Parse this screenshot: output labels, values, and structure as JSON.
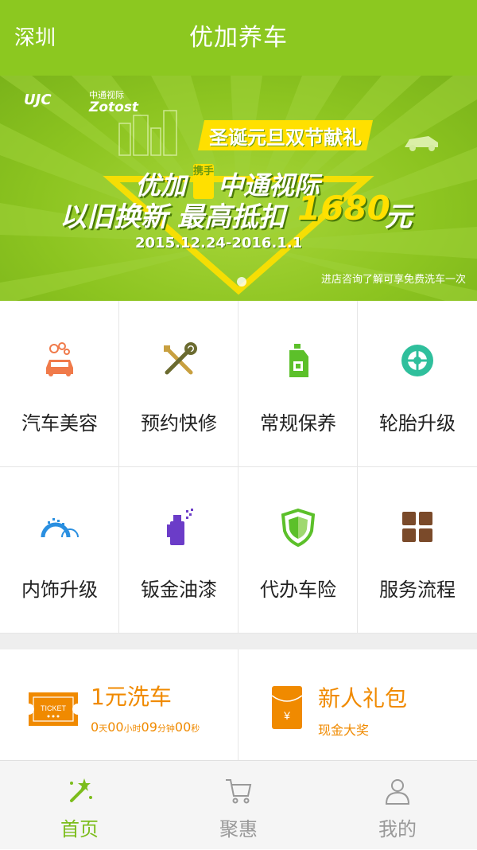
{
  "header": {
    "city": "深圳",
    "title": "优加养车"
  },
  "banner": {
    "brand_logo": "UJC",
    "partner_cn": "中通视际",
    "partner_en": "Zotost",
    "ribbon": "圣诞元旦双节献礼",
    "line1_a": "优加",
    "hand": "携手",
    "line1_b": "中通视际",
    "line2_a": "以旧换新 最高抵扣",
    "amount": "1680",
    "line2_b": "元",
    "date": "2015.12.24-2016.1.1",
    "note": "进店咨询了解可享免费洗车一次"
  },
  "services": [
    {
      "label": "汽车美容",
      "icon": "car-wash-icon"
    },
    {
      "label": "预约快修",
      "icon": "tools-icon"
    },
    {
      "label": "常规保养",
      "icon": "oil-bottle-icon"
    },
    {
      "label": "轮胎升级",
      "icon": "tire-icon"
    },
    {
      "label": "内饰升级",
      "icon": "interior-icon"
    },
    {
      "label": "钣金油漆",
      "icon": "spray-paint-icon"
    },
    {
      "label": "代办车险",
      "icon": "shield-icon"
    },
    {
      "label": "服务流程",
      "icon": "grid-icon"
    }
  ],
  "promos": {
    "wash": {
      "title": "1元洗车",
      "ticket": "TICKET",
      "countdown": {
        "days": "0",
        "days_unit": "天",
        "hours": "00",
        "hours_unit": "小时",
        "minutes": "09",
        "minutes_unit": "分钟",
        "seconds": "00",
        "seconds_unit": "秒"
      }
    },
    "gift": {
      "title": "新人礼包",
      "subtitle": "现金大奖",
      "symbol": "¥"
    }
  },
  "tabs": [
    {
      "label": "首页",
      "icon": "magic-wand-icon",
      "active": true
    },
    {
      "label": "聚惠",
      "icon": "cart-icon",
      "active": false
    },
    {
      "label": "我的",
      "icon": "user-icon",
      "active": false
    }
  ],
  "colors": {
    "brand_green": "#8cc820",
    "accent_orange": "#f08a00",
    "tab_active": "#7cbd1c"
  }
}
